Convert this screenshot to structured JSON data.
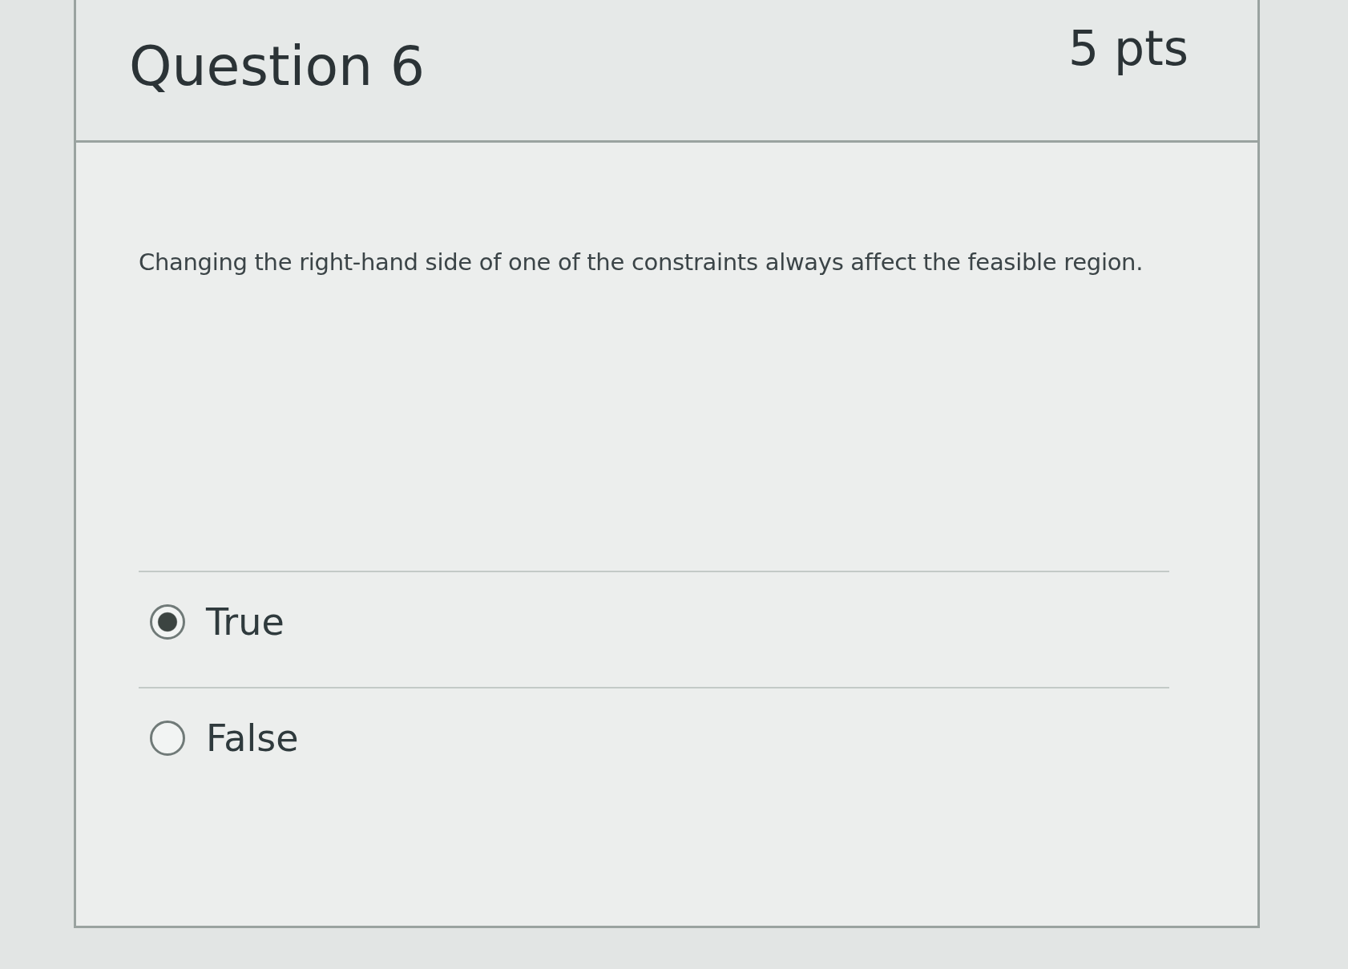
{
  "question": {
    "title": "Question 6",
    "points": "5 pts",
    "text": "Changing the right-hand side of one of the constraints always affect the feasible region."
  },
  "answers": [
    {
      "label": "True",
      "selected": true
    },
    {
      "label": "False",
      "selected": false
    }
  ]
}
